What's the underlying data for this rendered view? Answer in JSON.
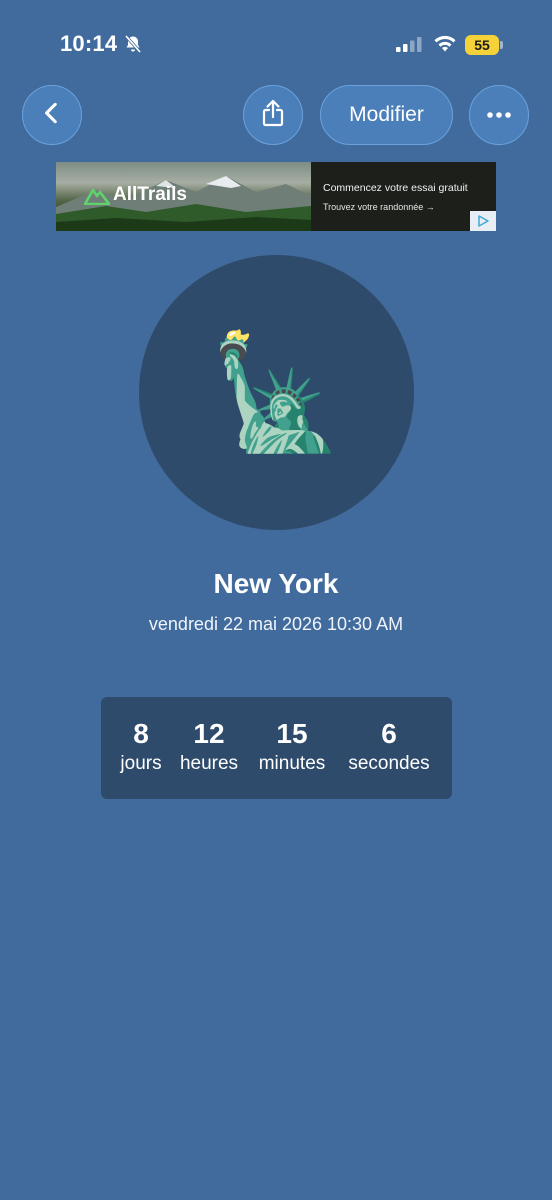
{
  "status_bar": {
    "time": "10:14",
    "battery": "55",
    "icons": [
      "bell-slash-icon",
      "signal-icon",
      "wifi-icon",
      "battery-icon"
    ]
  },
  "toolbar": {
    "back_icon": "chevron-left-icon",
    "share_icon": "share-icon",
    "edit_label": "Modifier",
    "more_icon": "ellipsis-icon"
  },
  "ad": {
    "brand": "AllTrails",
    "cta": "Commencez votre essai gratuit",
    "sub": "Trouvez votre randonnée →",
    "choice_icon": "ad-choices-icon"
  },
  "event": {
    "emoji": "🗽",
    "title": "New York",
    "date": "vendredi 22 mai 2026 10:30 AM"
  },
  "countdown": {
    "days": {
      "value": "8",
      "label": "jours"
    },
    "hours": {
      "value": "12",
      "label": "heures"
    },
    "minutes": {
      "value": "15",
      "label": "minutes"
    },
    "seconds": {
      "value": "6",
      "label": "secondes"
    }
  },
  "colors": {
    "background": "#416b9c",
    "button": "#4a7fba",
    "panel": "#2f4b6c",
    "battery": "#f5d13a"
  }
}
